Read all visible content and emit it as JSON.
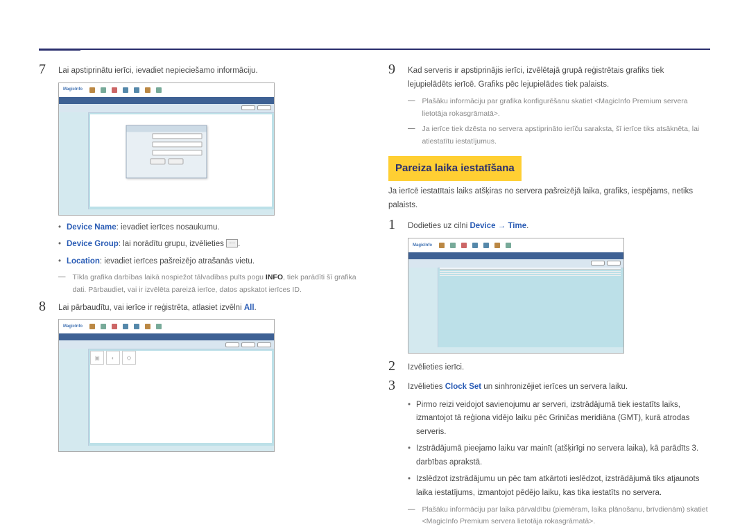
{
  "left": {
    "step7_num": "7",
    "step7_text": "Lai apstiprinātu ierīci, ievadiet nepieciešamo informāciju.",
    "bullets": {
      "b1_label": "Device Name",
      "b1_text": ": ievadiet ierīces nosaukumu.",
      "b2_label": "Device Group",
      "b2_text": ": lai norādītu grupu, izvēlieties ",
      "b2_end": ".",
      "b3_label": "Location",
      "b3_text": ": ievadiet ierīces pašreizējo atrašanās vietu."
    },
    "note1a": "Tīkla grafika darbības laikā nospiežot tālvadības pults pogu ",
    "note1_info": "INFO",
    "note1b": ", tiek parādīti šī grafika dati. Pārbaudiet, vai ir izvēlēta pareizā ierīce, datos apskatot ierīces ID.",
    "step8_num": "8",
    "step8a": "Lai pārbaudītu, vai ierīce ir reģistrēta, atlasiet izvēlni ",
    "step8_all": "All",
    "step8b": "."
  },
  "right": {
    "step9_num": "9",
    "step9_text": "Kad serveris ir apstiprinājis ierīci, izvēlētajā grupā reģistrētais grafiks tiek lejupielādēts ierīcē. Grafiks pēc lejupielādes tiek palaists.",
    "note_r1": "Plašāku informāciju par grafika konfigurēšanu skatiet <MagicInfo Premium servera lietotāja rokasgrāmatā>.",
    "note_r2": "Ja ierīce tiek dzēsta no servera apstiprināto ierīču saraksta, šī ierīce tiks atsāknēta, lai atiestatītu iestatījumus.",
    "heading": "Pareiza laika iestatīšana",
    "intro": "Ja ierīcē iestatītais laiks atšķiras no servera pašreizējā laika, grafiks, iespējams, netiks palaists.",
    "step1_num": "1",
    "step1a": "Dodieties uz cilni ",
    "step1_dev": "Device",
    "step1_arrow": " → ",
    "step1_time": "Time",
    "step1b": ".",
    "step2_num": "2",
    "step2_text": "Izvēlieties ierīci.",
    "step3_num": "3",
    "step3a": "Izvēlieties ",
    "step3_clock": "Clock Set",
    "step3b": " un sinhronizējiet ierīces un servera laiku.",
    "bullets2": {
      "b1": "Pirmo reizi veidojot savienojumu ar serveri, izstrādājumā tiek iestatīts laiks, izmantojot tā reģiona vidējo laiku pēc Griničas meridiāna (GMT), kurā atrodas serveris.",
      "b2": "Izstrādājumā pieejamo laiku var mainīt (atšķirīgi no servera laika), kā parādīts 3. darbības aprakstā.",
      "b3": "Izslēdzot izstrādājumu un pēc tam atkārtoti ieslēdzot, izstrādājumā tiks atjaunots laika iestatījums, izmantojot pēdējo laiku, kas tika iestatīts no servera."
    },
    "note_r3": "Plašāku informāciju par laika pārvaldību (piemēram, laika plānošanu, brīvdienām) skatiet <MagicInfo Premium servera lietotāja rokasgrāmatā>.",
    "ss_logo": "MagicInfo"
  }
}
